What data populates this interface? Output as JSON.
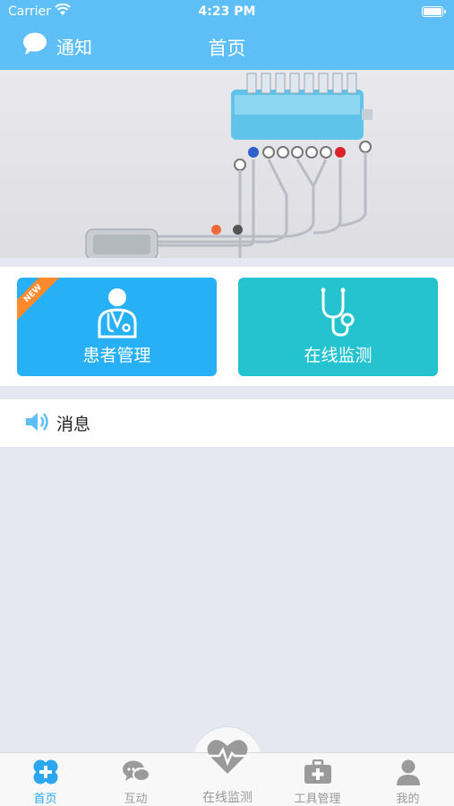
{
  "status_bar": {
    "carrier": "Carrier",
    "time": "4:23 PM"
  },
  "nav": {
    "notice_label": "通知",
    "title": "首页"
  },
  "banner": {
    "active_dot_color": "#f26a3c",
    "inactive_dot_color": "#555555"
  },
  "cards": [
    {
      "label": "患者管理",
      "badge": "NEW",
      "color": "#28b0f6",
      "icon": "doctor-icon"
    },
    {
      "label": "在线监测",
      "color": "#25c3cf",
      "icon": "stethoscope-icon"
    }
  ],
  "messages": {
    "label": "消息",
    "icon": "speaker-icon"
  },
  "tabs": [
    {
      "label": "首页",
      "icon": "home-cross-icon",
      "active": true
    },
    {
      "label": "互动",
      "icon": "chat-bubbles-icon"
    },
    {
      "label": "在线监测",
      "icon": "heart-pulse-icon"
    },
    {
      "label": "工具管理",
      "icon": "medical-kit-icon"
    },
    {
      "label": "我的",
      "icon": "person-icon"
    }
  ],
  "colors": {
    "primary": "#5ebff7",
    "tab_active": "#2aa7ef",
    "background": "#e6e7f0"
  }
}
